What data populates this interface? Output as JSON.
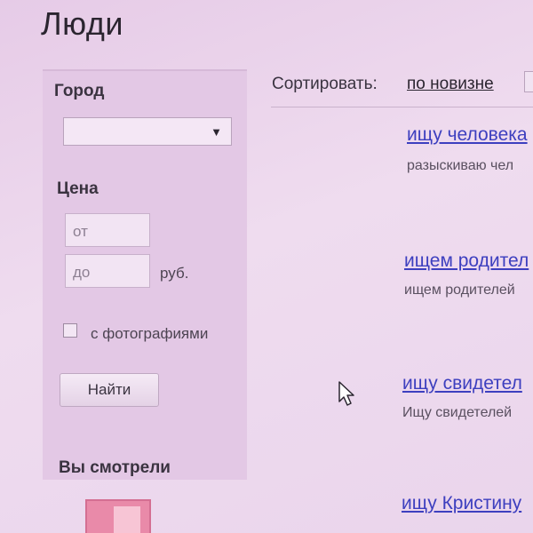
{
  "page": {
    "title": "Люди"
  },
  "filters": {
    "city_heading": "Город",
    "city_value": "",
    "price_heading": "Цена",
    "price_from_placeholder": "от",
    "price_to_placeholder": "до",
    "currency": "руб.",
    "with_photos_label": "с фотографиями",
    "with_photos_checked": false,
    "search_button": "Найти",
    "viewed_heading": "Вы смотрели"
  },
  "sort": {
    "label": "Сортировать:",
    "options": [
      "по новизне"
    ]
  },
  "listings": [
    {
      "title": "ищу человека",
      "description": "разыскиваю чел"
    },
    {
      "title": "ищем родител",
      "description": "ищем родителей"
    },
    {
      "title": "ищу свидетел",
      "description": "Ищу свидетелей"
    },
    {
      "title": "ищу Кристину",
      "description": ""
    }
  ],
  "icons": {
    "select_arrow": "chevron-down-icon",
    "cursor": "mouse-pointer-icon"
  },
  "colors": {
    "link": "#3d3fbf",
    "background": "#ead4ea",
    "sidebar": "#e3c8e5"
  }
}
